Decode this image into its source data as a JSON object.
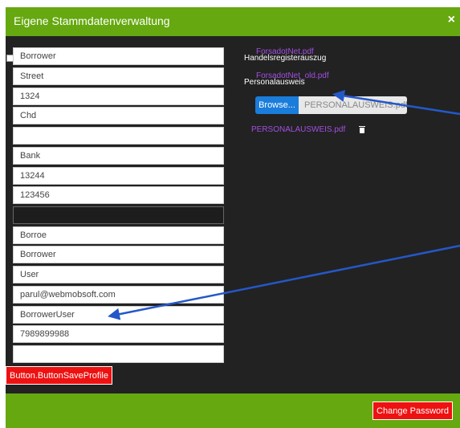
{
  "modal": {
    "title": "Eigene Stammdatenverwaltung",
    "close_symbol": "×"
  },
  "form": {
    "fields": [
      {
        "value": "Borrower",
        "placeholder": ""
      },
      {
        "value": "Street",
        "placeholder": ""
      },
      {
        "value": "1324",
        "placeholder": ""
      },
      {
        "value": "Chd",
        "placeholder": ""
      },
      {
        "value": "",
        "placeholder": ""
      },
      {
        "value": "Bank",
        "placeholder": ""
      },
      {
        "value": "13244",
        "placeholder": ""
      },
      {
        "value": "123456",
        "placeholder": ""
      },
      {
        "value": "",
        "placeholder": ""
      },
      {
        "value": "Borroe",
        "placeholder": ""
      },
      {
        "value": "Borrower",
        "placeholder": ""
      },
      {
        "value": "User",
        "placeholder": ""
      },
      {
        "value": "parul@webmobsoft.com",
        "placeholder": ""
      },
      {
        "value": "BorrowerUser",
        "placeholder": ""
      },
      {
        "value": "7989899988",
        "placeholder": ""
      },
      {
        "value": "",
        "placeholder": ""
      }
    ],
    "save_button_label": "Button.ButtonSaveProfile"
  },
  "documents": {
    "handelsregister_link": "ForsadotNet.pdf",
    "handelsregister_label": "Handelsregisterauszug",
    "personalausweis_link": "ForsadotNet_old.pdf",
    "personalausweis_label": "Personalausweis",
    "browse_label": "Browse...",
    "selected_file": "PERSONALAUSWEIS.pdf",
    "uploaded_file_link": "PERSONALAUSWEIS.pdf"
  },
  "footer": {
    "change_password_label": "Change Password"
  },
  "colors": {
    "header_green": "#66a810",
    "modal_dark": "#222222",
    "link_purple": "#a24fe0",
    "button_red": "#ee1111",
    "browse_blue": "#1a7ddb",
    "annotation_arrow": "#2458c8"
  },
  "icons": {
    "close": "close-icon",
    "trash": "trash-icon",
    "checkbox": "checkbox"
  }
}
